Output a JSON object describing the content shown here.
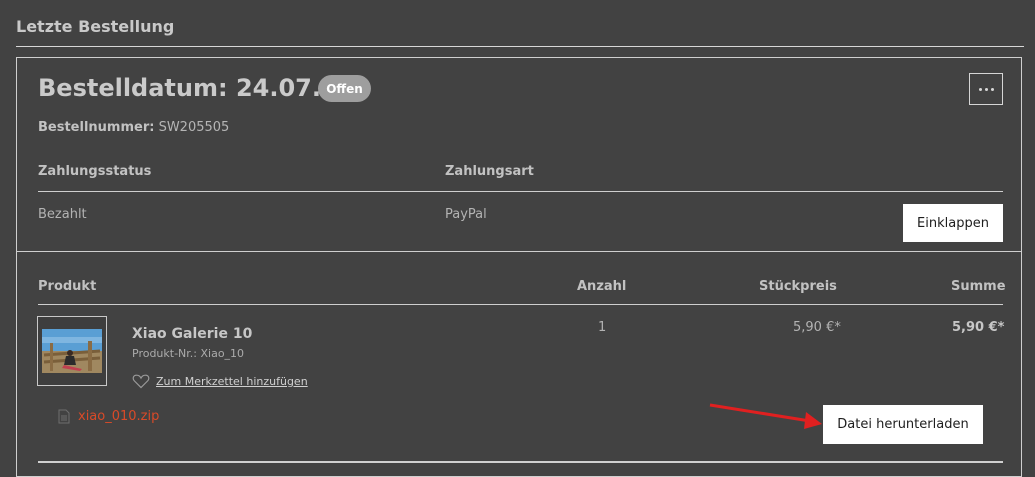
{
  "section": {
    "title": "Letzte Bestellung"
  },
  "order": {
    "date_label": "Bestelldatum: 24.07.24",
    "status_badge": "Offen",
    "number_label": "Bestellnummer:",
    "number_value": "SW205505"
  },
  "payment": {
    "status_header": "Zahlungsstatus",
    "method_header": "Zahlungsart",
    "status_value": "Bezahlt",
    "method_value": "PayPal"
  },
  "buttons": {
    "collapse": "Einklappen",
    "download": "Datei herunterladen",
    "more": "more-options-icon"
  },
  "table": {
    "headers": {
      "product": "Produkt",
      "qty": "Anzahl",
      "unit_price": "Stückpreis",
      "total": "Summe"
    },
    "row": {
      "name": "Xiao Galerie 10",
      "product_no": "Produkt-Nr.: Xiao_10",
      "wishlist": "Zum Merkzettel hinzufügen",
      "qty": "1",
      "unit_price": "5,90 €*",
      "total": "5,90 €*"
    }
  },
  "download": {
    "file_name": "xiao_010.zip",
    "file_icon": "file-icon"
  },
  "colors": {
    "background": "#424242",
    "accent_file": "#d94a28",
    "badge": "#9e9e9e",
    "annotation_arrow": "#e02020"
  }
}
